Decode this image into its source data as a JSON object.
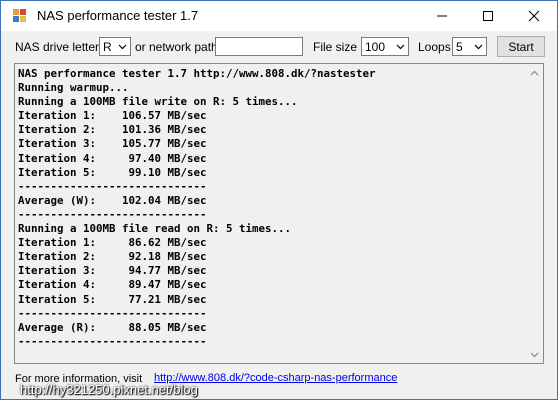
{
  "window": {
    "title": "NAS performance tester 1.7"
  },
  "toolbar": {
    "drive_label": "NAS drive letter",
    "drive_value": "R",
    "network_label": "or network path",
    "network_value": "",
    "filesize_label": "File size",
    "filesize_value": "100",
    "loops_label": "Loops",
    "loops_value": "5",
    "start_label": "Start"
  },
  "output": {
    "lines": [
      "NAS performance tester 1.7 http://www.808.dk/?nastester",
      "Running warmup...",
      "Running a 100MB file write on R: 5 times...",
      "Iteration 1:    106.57 MB/sec",
      "Iteration 2:    101.36 MB/sec",
      "Iteration 3:    105.77 MB/sec",
      "Iteration 4:     97.40 MB/sec",
      "Iteration 5:     99.10 MB/sec",
      "-----------------------------",
      "Average (W):    102.04 MB/sec",
      "-----------------------------",
      "Running a 100MB file read on R: 5 times...",
      "Iteration 1:     86.62 MB/sec",
      "Iteration 2:     92.18 MB/sec",
      "Iteration 3:     94.77 MB/sec",
      "Iteration 4:     89.47 MB/sec",
      "Iteration 5:     77.21 MB/sec",
      "-----------------------------",
      "Average (R):     88.05 MB/sec",
      "-----------------------------"
    ]
  },
  "footer": {
    "label": "For more information, visit",
    "link": "http://www.808.dk/?code-csharp-nas-performance"
  },
  "watermark": {
    "text": "http://hy321250.pixnet.net/blog"
  },
  "icons": {
    "app": "app-icon",
    "minimize": "minimize-icon",
    "maximize": "maximize-icon",
    "close": "close-icon",
    "dropdown": "chevron-down-icon"
  }
}
